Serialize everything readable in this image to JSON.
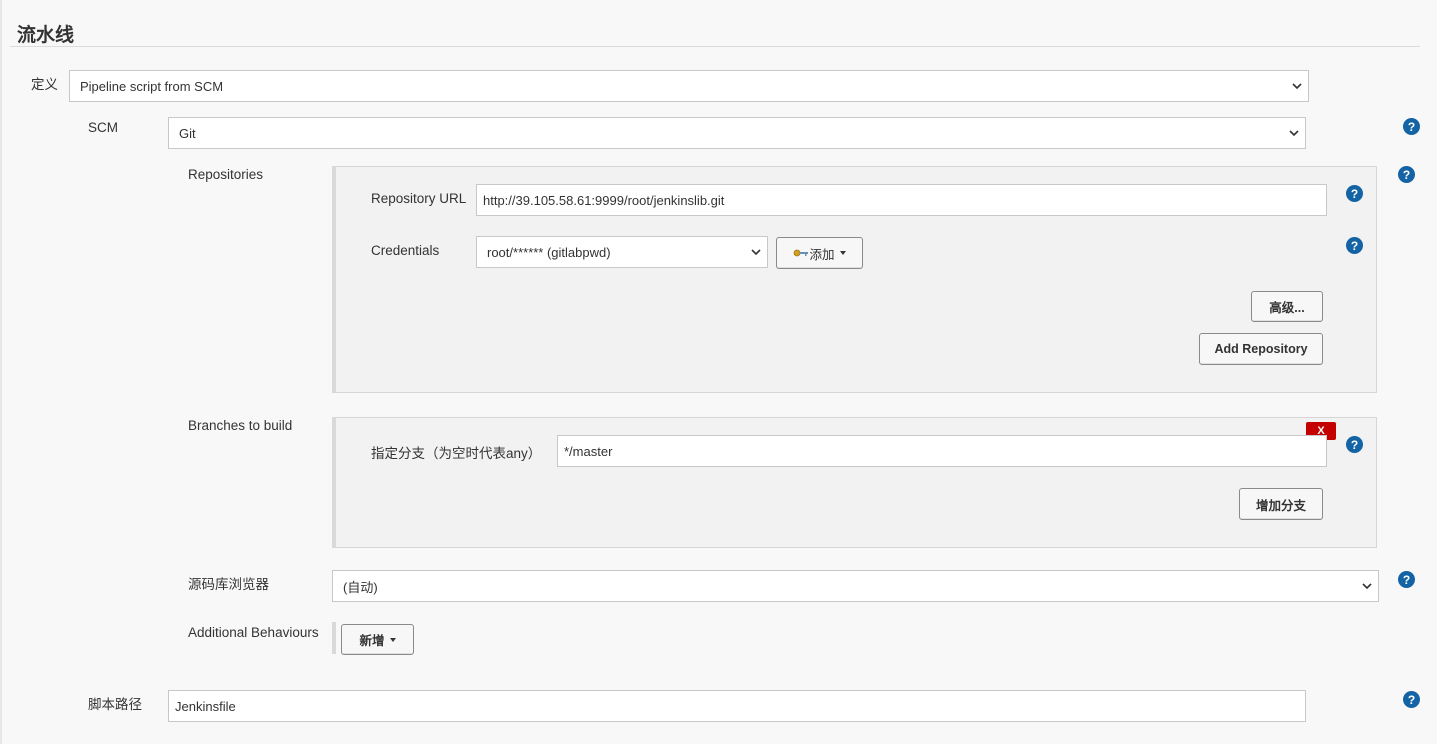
{
  "section": {
    "title": "流水线"
  },
  "definition": {
    "label": "定义",
    "value": "Pipeline script from SCM"
  },
  "scm": {
    "label": "SCM",
    "value": "Git"
  },
  "repositories": {
    "label": "Repositories",
    "url_label": "Repository URL",
    "url_value": "http://39.105.58.61:9999/root/jenkinslib.git",
    "credentials_label": "Credentials",
    "credentials_value": "root/****** (gitlabpwd)",
    "add_label": "添加",
    "advanced_label": "高级...",
    "add_repository_label": "Add Repository"
  },
  "branches": {
    "label": "Branches to build",
    "spec_label": "指定分支（为空时代表any）",
    "spec_value": "*/master",
    "delete_label": "X",
    "add_branch_label": "增加分支"
  },
  "browser": {
    "label": "源码库浏览器",
    "value": "(自动)"
  },
  "behaviours": {
    "label": "Additional Behaviours",
    "add_label": "新增"
  },
  "script_path": {
    "label": "脚本路径",
    "value": "Jenkinsfile"
  },
  "help": {
    "glyph": "?"
  },
  "colors": {
    "help": "#1463a5",
    "delete": "#c40000",
    "panel": "#f2f2f2"
  }
}
